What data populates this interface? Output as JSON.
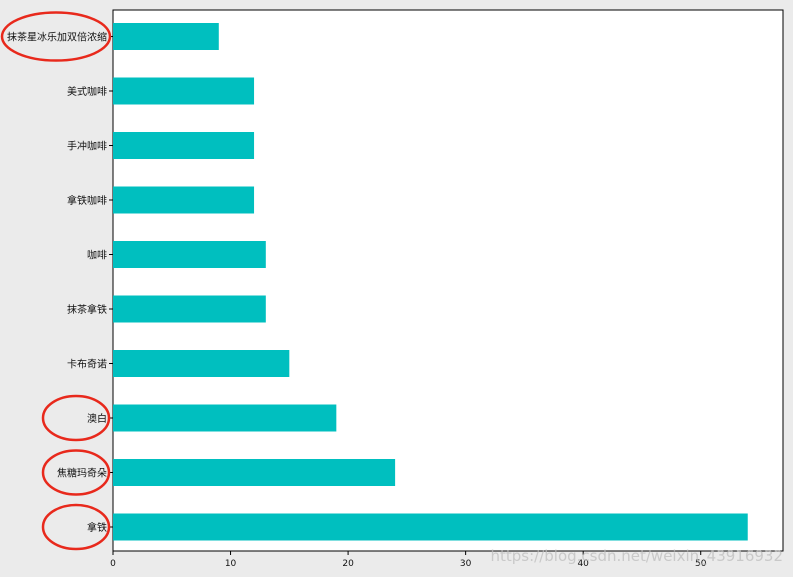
{
  "chart_data": {
    "type": "bar",
    "orientation": "horizontal",
    "categories": [
      "抹茶星冰乐加双倍浓缩",
      "美式咖啡",
      "手冲咖啡",
      "拿铁咖啡",
      "咖啡",
      "抹茶拿铁",
      "卡布奇诺",
      "澳白",
      "焦糖玛奇朵",
      "拿铁"
    ],
    "values": [
      9,
      12,
      12,
      12,
      13,
      13,
      15,
      19,
      24,
      54
    ],
    "xticks": [
      "0",
      "10",
      "20",
      "30",
      "40",
      "50"
    ],
    "xlim": [
      0,
      57
    ],
    "bar_color": "#00bfbf",
    "grid": false,
    "title": "",
    "xlabel": "",
    "ylabel": "",
    "annotations": {
      "circled_categories": [
        "抹茶星冰乐加双倍浓缩",
        "澳白",
        "焦糖玛奇朵",
        "拿铁"
      ],
      "circle_color": "#e8291c"
    }
  },
  "watermark": "https://blog.csdn.net/weixin_43916932"
}
